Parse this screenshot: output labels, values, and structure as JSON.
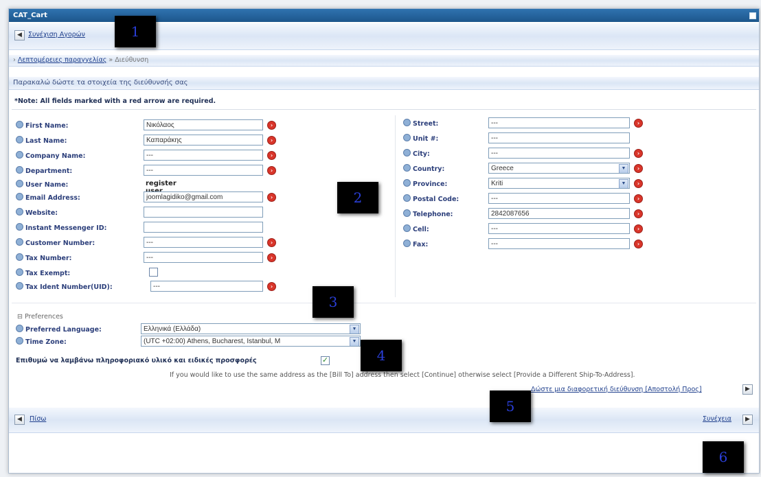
{
  "window": {
    "title": "CAT_Cart"
  },
  "top_nav": {
    "back_label": "Συνέχιση Αγορών"
  },
  "breadcrumb": {
    "parent": "Λεπτομέρειες παραγγελίας",
    "separator": "»",
    "current": "Διεύθυνση"
  },
  "section_header": "Παρακαλώ δώστε τα στοιχεία της διεύθυνσής σας",
  "note": "*Note: All fields marked with a red arrow are required.",
  "left_fields": [
    {
      "label": "First Name:",
      "value": "Νικόλαος"
    },
    {
      "label": "Last Name:",
      "value": "Καπαράκης"
    },
    {
      "label": "Company Name:",
      "value": "---"
    },
    {
      "label": "Department:",
      "value": "---"
    },
    {
      "label": "User Name:",
      "value": "register user example"
    },
    {
      "label": "Email Address:",
      "value": "joomlagidiko@gmail.com"
    },
    {
      "label": "Website:",
      "value": ""
    },
    {
      "label": "Instant Messenger ID:",
      "value": ""
    },
    {
      "label": "Customer Number:",
      "value": "---"
    },
    {
      "label": "Tax Number:",
      "value": "---"
    },
    {
      "label": "Tax Exempt:",
      "value": ""
    },
    {
      "label": "Tax Ident Number(UID):",
      "value": "---"
    }
  ],
  "right_fields": [
    {
      "label": "Street:",
      "value": "---"
    },
    {
      "label": "Unit #:",
      "value": "---"
    },
    {
      "label": "City:",
      "value": "---"
    },
    {
      "label": "Country:",
      "value": "Greece"
    },
    {
      "label": "Province:",
      "value": "Kriti"
    },
    {
      "label": "Postal Code:",
      "value": "---"
    },
    {
      "label": "Telephone:",
      "value": "2842087656"
    },
    {
      "label": "Cell:",
      "value": "---"
    },
    {
      "label": "Fax:",
      "value": "---"
    }
  ],
  "preferences": {
    "title": "Preferences",
    "toggle": "⊟",
    "language_label": "Preferred Language:",
    "language_value": "Ελληνικά (Ελλάδα)",
    "timezone_label": "Time Zone:",
    "timezone_value": "(UTC +02:00) Athens, Bucharest, Istanbul, M"
  },
  "newsletter": {
    "label": "Επιθυμώ να λαμβάνω πληροφοριακό υλικό και ειδικές προσφορές",
    "checked": true
  },
  "info_text": "If you would like to use the same address as the [Bill To] address then select [Continue] otherwise select [Provide a Different Ship-To-Address].",
  "different_address_link": "Δώστε μια διαφορετική διεύθυνση [Αποστολή Προς]",
  "bottom_nav": {
    "back_label": "Πίσω",
    "next_label": "Συνέχεια"
  },
  "markers": [
    "1",
    "2",
    "3",
    "4",
    "5",
    "6"
  ],
  "colors": {
    "titlebar": "#1d568b",
    "label": "#2b3e7a",
    "required": "#d9352a",
    "link": "#1f3f8c"
  }
}
